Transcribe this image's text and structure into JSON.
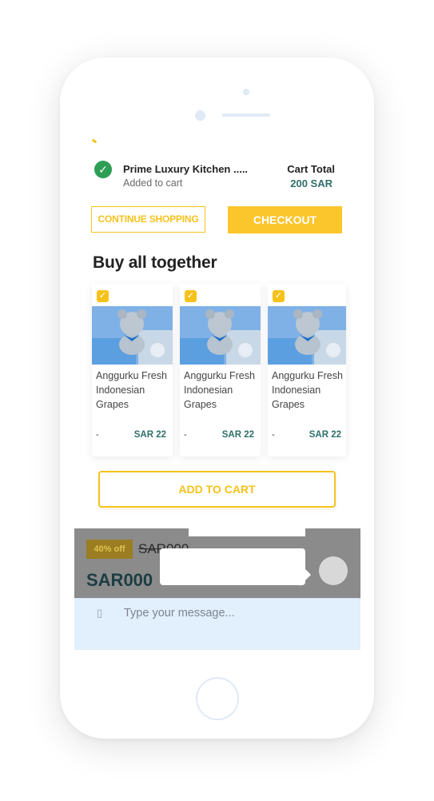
{
  "cart_notice": {
    "product_name": "Prime Luxury Kitchen .....",
    "status": "Added to cart",
    "total_label": "Cart Total",
    "total_value": "200 SAR"
  },
  "actions": {
    "continue_label": "CONTINUE SHOPPING",
    "checkout_label": "CHECKOUT"
  },
  "bundle": {
    "title": "Buy all together",
    "products": [
      {
        "name": "Anggurku Fresh Indonesian Grapes",
        "dash": "-",
        "price": "SAR 22",
        "checked": true
      },
      {
        "name": "Anggurku Fresh Indonesian Grapes",
        "dash": "-",
        "price": "SAR 22",
        "checked": true
      },
      {
        "name": "Anggurku Fresh Indonesian Grapes",
        "dash": "-",
        "price": "SAR 22",
        "checked": true
      }
    ],
    "add_label": "ADD TO CART"
  },
  "product_panel": {
    "discount": "40% off",
    "old_price": "SAR000",
    "new_price": "SAR000"
  },
  "chat": {
    "icon": "attachment-icon",
    "placeholder": "Type your message..."
  },
  "colors": {
    "accent": "#f6c21a",
    "success": "#2e9e55",
    "price_teal": "#2f6f6a"
  }
}
